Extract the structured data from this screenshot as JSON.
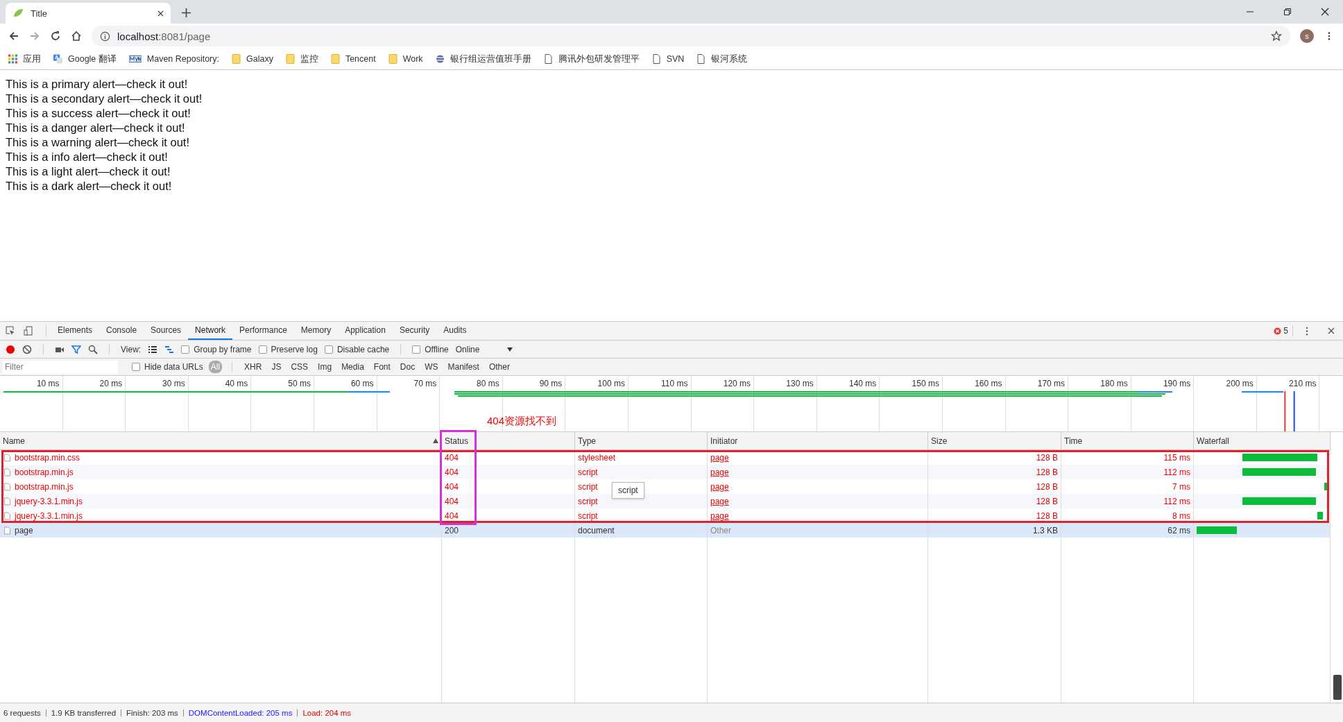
{
  "browser_tab": {
    "title": "Title"
  },
  "address": {
    "host": "localhost",
    "path": ":8081/page"
  },
  "avatar": {
    "letter": "s"
  },
  "bookmarks": [
    {
      "kind": "apps",
      "label": "应用"
    },
    {
      "kind": "translate",
      "label": "Google 翻译"
    },
    {
      "kind": "maven",
      "label": "Maven Repository:"
    },
    {
      "kind": "folder",
      "label": "Galaxy"
    },
    {
      "kind": "folder",
      "label": "监控"
    },
    {
      "kind": "folder",
      "label": "Tencent"
    },
    {
      "kind": "folder",
      "label": "Work"
    },
    {
      "kind": "site",
      "label": "银行组运营值班手册"
    },
    {
      "kind": "page",
      "label": "腾讯外包研发管理平"
    },
    {
      "kind": "page",
      "label": "SVN"
    },
    {
      "kind": "page",
      "label": "银河系统"
    }
  ],
  "page_lines": [
    "This is a primary alert—check it out!",
    "This is a secondary alert—check it out!",
    "This is a success alert—check it out!",
    "This is a danger alert—check it out!",
    "This is a warning alert—check it out!",
    "This is a info alert—check it out!",
    "This is a light alert—check it out!",
    "This is a dark alert—check it out!"
  ],
  "devtools": {
    "tabs": [
      {
        "label": "Elements",
        "selected": false
      },
      {
        "label": "Console",
        "selected": false
      },
      {
        "label": "Sources",
        "selected": false
      },
      {
        "label": "Network",
        "selected": true
      },
      {
        "label": "Performance",
        "selected": false
      },
      {
        "label": "Memory",
        "selected": false
      },
      {
        "label": "Application",
        "selected": false
      },
      {
        "label": "Security",
        "selected": false
      },
      {
        "label": "Audits",
        "selected": false
      }
    ],
    "error_count": "5",
    "toolbar": {
      "recording": true,
      "view_label": "View:",
      "checkboxes": [
        {
          "label": "Group by frame",
          "checked": false
        },
        {
          "label": "Preserve log",
          "checked": false
        },
        {
          "label": "Disable cache",
          "checked": false
        },
        {
          "label": "Offline",
          "checked": false
        }
      ],
      "throttling": "Online"
    },
    "filter": {
      "placeholder": "Filter",
      "hide_data_urls": {
        "label": "Hide data URLs",
        "checked": false
      },
      "types": [
        {
          "label": "All",
          "selected": true
        },
        {
          "label": "XHR",
          "selected": false
        },
        {
          "label": "JS",
          "selected": false
        },
        {
          "label": "CSS",
          "selected": false
        },
        {
          "label": "Img",
          "selected": false
        },
        {
          "label": "Media",
          "selected": false
        },
        {
          "label": "Font",
          "selected": false
        },
        {
          "label": "Doc",
          "selected": false
        },
        {
          "label": "WS",
          "selected": false
        },
        {
          "label": "Manifest",
          "selected": false
        },
        {
          "label": "Other",
          "selected": false
        }
      ]
    },
    "overview_ticks": [
      "10 ms",
      "20 ms",
      "30 ms",
      "40 ms",
      "50 ms",
      "60 ms",
      "70 ms",
      "80 ms",
      "90 ms",
      "100 ms",
      "110 ms",
      "120 ms",
      "130 ms",
      "140 ms",
      "150 ms",
      "160 ms",
      "170 ms",
      "180 ms",
      "190 ms",
      "200 ms",
      "210 ms"
    ],
    "table": {
      "columns": [
        "Name",
        "Status",
        "Type",
        "Initiator",
        "Size",
        "Time",
        "Waterfall"
      ],
      "rows": [
        {
          "name": "bootstrap.min.css",
          "status": "404",
          "type": "stylesheet",
          "initiator": "page",
          "size": "128 B",
          "time": "115 ms",
          "error": true,
          "selected": false
        },
        {
          "name": "bootstrap.min.js",
          "status": "404",
          "type": "script",
          "initiator": "page",
          "size": "128 B",
          "time": "112 ms",
          "error": true,
          "selected": false
        },
        {
          "name": "bootstrap.min.js",
          "status": "404",
          "type": "script",
          "initiator": "page",
          "size": "128 B",
          "time": "7 ms",
          "error": true,
          "selected": false
        },
        {
          "name": "jquery-3.3.1.min.js",
          "status": "404",
          "type": "script",
          "initiator": "page",
          "size": "128 B",
          "time": "112 ms",
          "error": true,
          "selected": false
        },
        {
          "name": "jquery-3.3.1.min.js",
          "status": "404",
          "type": "script",
          "initiator": "page",
          "size": "128 B",
          "time": "8 ms",
          "error": true,
          "selected": false
        },
        {
          "name": "page",
          "status": "200",
          "type": "document",
          "initiator": "Other",
          "size": "1.3 KB",
          "time": "62 ms",
          "error": false,
          "selected": true
        }
      ]
    },
    "tooltip": "script",
    "status_bar": [
      {
        "kind": "plain",
        "text": "6 requests"
      },
      {
        "kind": "plain",
        "text": "1.9 KB transferred"
      },
      {
        "kind": "plain",
        "text": "Finish: 203 ms"
      },
      {
        "kind": "dom",
        "text": "DOMContentLoaded: 205 ms"
      },
      {
        "kind": "load",
        "text": "Load: 204 ms"
      }
    ]
  },
  "annotation": {
    "label": "404资源找不到"
  }
}
